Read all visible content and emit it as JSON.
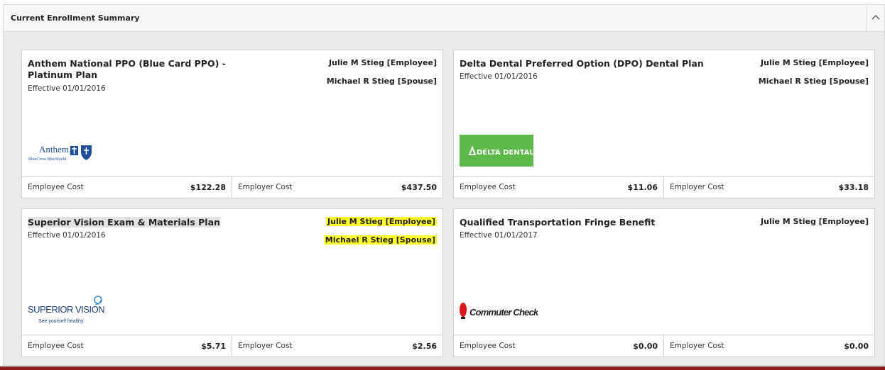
{
  "panel": {
    "title": "Current Enrollment Summary"
  },
  "cards": [
    {
      "plan_name": "Anthem National PPO (Blue Card PPO) - Platinum Plan",
      "effective": "Effective 01/01/2016",
      "members": [
        "Julie M Stieg [Employee]",
        "Michael R Stieg [Spouse]"
      ],
      "logo": "anthem-bluecross-blueshield-logo",
      "logo_text": "Anthem.",
      "logo_subtext": "BlueCross BlueShield",
      "employee_cost_label": "Employee Cost",
      "employee_cost": "$122.28",
      "employer_cost_label": "Employer Cost",
      "employer_cost": "$437.50"
    },
    {
      "plan_name": "Delta Dental Preferred Option (DPO) Dental Plan",
      "effective": "Effective 01/01/2016",
      "members": [
        "Julie M Stieg [Employee]",
        "Michael R Stieg [Spouse]"
      ],
      "logo": "delta-dental-logo",
      "logo_text": "DELTA DENTAL",
      "employee_cost_label": "Employee Cost",
      "employee_cost": "$11.06",
      "employer_cost_label": "Employer Cost",
      "employer_cost": "$33.18"
    },
    {
      "plan_name": "Superior Vision Exam & Materials Plan",
      "effective": "Effective 01/01/2016",
      "members": [
        "Julie M Stieg [Employee]",
        "Michael R Stieg [Spouse]"
      ],
      "logo": "superior-vision-logo",
      "logo_text": "SUPERIOR VISION",
      "logo_subtext": "See yourself healthy.",
      "employee_cost_label": "Employee Cost",
      "employee_cost": "$5.71",
      "employer_cost_label": "Employer Cost",
      "employer_cost": "$2.56"
    },
    {
      "plan_name": "Qualified Transportation Fringe Benefit",
      "effective": "Effective 01/01/2017",
      "members": [
        "Julie M Stieg [Employee]"
      ],
      "logo": "commuter-check-logo",
      "logo_text": "Commuter Check",
      "employee_cost_label": "Employee Cost",
      "employee_cost": "$0.00",
      "employer_cost_label": "Employer Cost",
      "employer_cost": "$0.00"
    }
  ],
  "colors": {
    "highlight": "#ffff2a",
    "delta_green": "#5cb848",
    "anthem_blue": "#1f4e9a",
    "commuter_red": "#d8161b",
    "bottom_bar": "#8b1a1a"
  }
}
